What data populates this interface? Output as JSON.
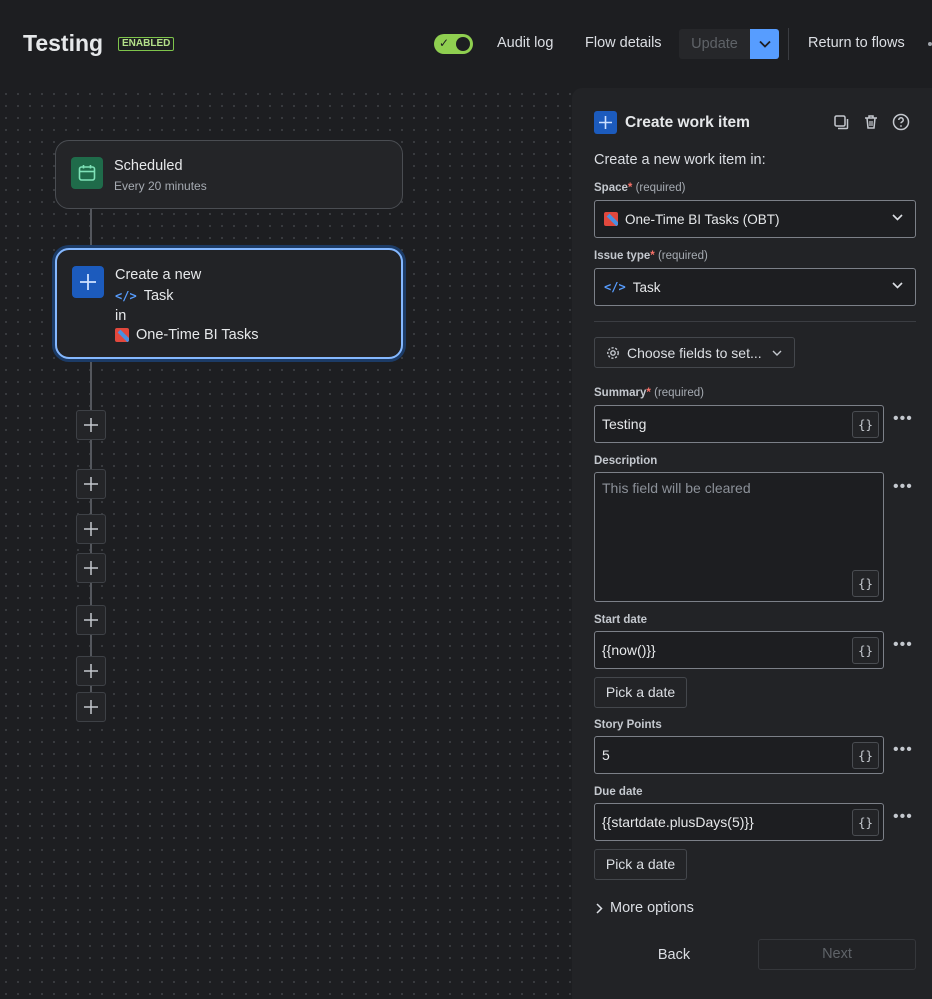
{
  "header": {
    "title": "Testing",
    "badge": "ENABLED",
    "audit_log": "Audit log",
    "flow_details": "Flow details",
    "update": "Update",
    "return_to_flows": "Return to flows"
  },
  "flow": {
    "trigger": {
      "title": "Scheduled",
      "subtitle": "Every 20 minutes",
      "icon": "calendar-icon"
    },
    "action": {
      "line1": "Create a new",
      "issue_type": "Task",
      "line3": "in",
      "space": "One-Time BI Tasks",
      "icon": "plus-icon"
    },
    "add_button_count": 7
  },
  "panel": {
    "title": "Create work item",
    "intro": "Create a new work item in:",
    "space": {
      "label": "Space",
      "required_text": "(required)",
      "value": "One-Time BI Tasks (OBT)"
    },
    "issue_type": {
      "label": "Issue type",
      "required_text": "(required)",
      "value": "Task"
    },
    "choose_fields": "Choose fields to set...",
    "summary": {
      "label": "Summary",
      "required_text": "(required)",
      "value": "Testing"
    },
    "description": {
      "label": "Description",
      "placeholder": "This field will be cleared"
    },
    "start_date": {
      "label": "Start date",
      "value": "{{now()}}",
      "pick": "Pick a date"
    },
    "story_points": {
      "label": "Story Points",
      "value": "5"
    },
    "due_date": {
      "label": "Due date",
      "value": "{{startdate.plusDays(5)}}",
      "pick": "Pick a date"
    },
    "more_options": "More options",
    "back": "Back",
    "next": "Next",
    "brace_label": "{}",
    "dots": "•••",
    "required_mark": "*"
  },
  "colors": {
    "accent": "#579dff",
    "toggle_on": "#8fcf50",
    "enabled_badge": "#7ec44b",
    "trigger_icon_bg": "#1f6b4a",
    "action_icon_bg": "#1c5bbd"
  }
}
